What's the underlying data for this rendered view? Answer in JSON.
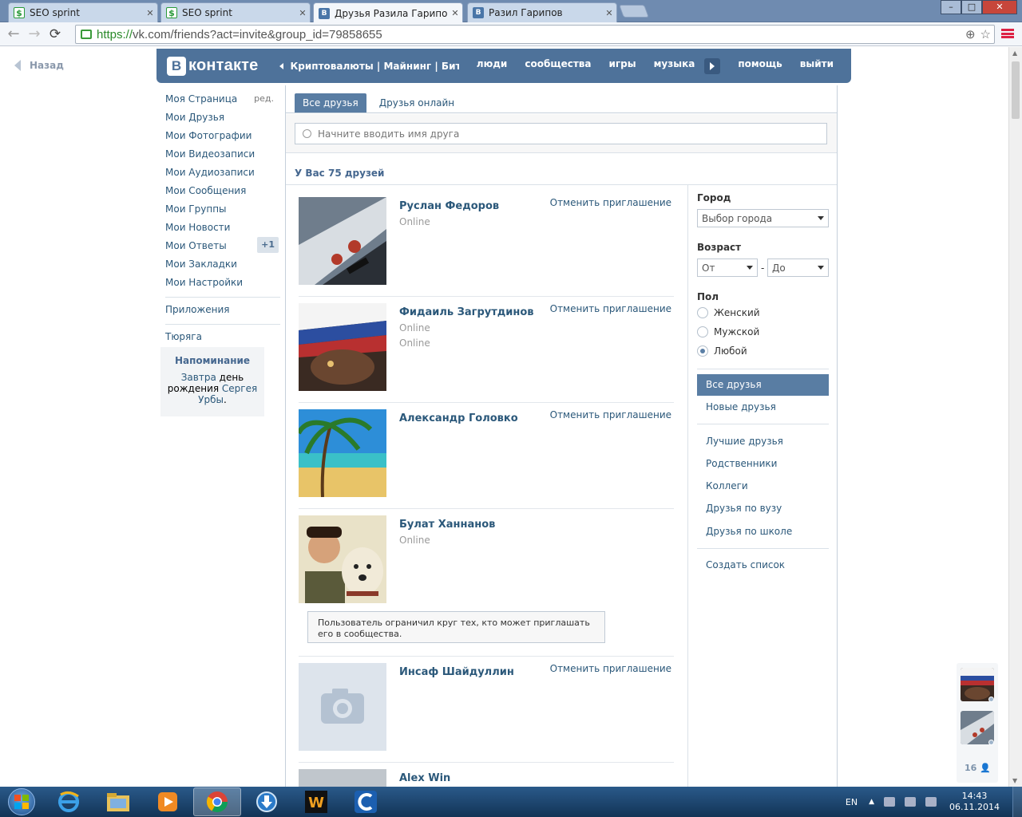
{
  "browser": {
    "tabs": [
      {
        "title": "SEO sprint",
        "icon": "seo-favicon",
        "active": false
      },
      {
        "title": "SEO sprint",
        "icon": "seo-favicon",
        "active": false
      },
      {
        "title": "Друзья Разила Гарипова",
        "icon": "vk-favicon",
        "active": true
      },
      {
        "title": "Разил Гарипов",
        "icon": "vk-favicon",
        "active": false
      }
    ],
    "url_scheme": "https://",
    "url_rest": "vk.com/friends?act=invite&group_id=79858655"
  },
  "page": {
    "back_label": "Назад"
  },
  "header": {
    "logo_letter": "В",
    "logo_text": "контакте",
    "ticker": "Криптовалюты | Майнинг | Битк...",
    "nav": [
      "люди",
      "сообщества",
      "игры",
      "музыка"
    ],
    "nav_right": [
      "помощь",
      "выйти"
    ]
  },
  "left_menu": {
    "items": [
      "Моя Страница",
      "Мои Друзья",
      "Мои Фотографии",
      "Мои Видеозаписи",
      "Мои Аудиозаписи",
      "Мои Сообщения",
      "Мои Группы",
      "Мои Новости",
      "Мои Ответы",
      "Мои Закладки",
      "Мои Настройки"
    ],
    "edit_label": "ред.",
    "answers_badge": "+1",
    "apps": "Приложения",
    "extra": "Тюряга"
  },
  "reminder": {
    "title": "Напоминание",
    "tomorrow": "Завтра",
    "day": " день",
    "birthday": "рождения ",
    "name1": "Сергея",
    "name2": "Урбы",
    "dot": "."
  },
  "friends": {
    "tabs": [
      "Все друзья",
      "Друзья онлайн"
    ],
    "search_placeholder": "Начните вводить имя друга",
    "count": "У Вас 75 друзей",
    "cancel_label": "Отменить приглашение",
    "items": [
      {
        "name": "Руслан Федоров",
        "status": [
          "Online"
        ]
      },
      {
        "name": "Фидаиль Загрутдинов",
        "status": [
          "Online",
          "Online"
        ]
      },
      {
        "name": "Александр Головко",
        "status": []
      },
      {
        "name": "Булат Ханнанов",
        "status": [
          "Online"
        ],
        "note": "Пользователь ограничил круг тех, кто может приглашать его в сообщества."
      },
      {
        "name": "Инсаф Шайдуллин",
        "status": []
      },
      {
        "name": "Alex Win",
        "status": []
      }
    ]
  },
  "filters": {
    "city_label": "Город",
    "city_value": "Выбор города",
    "age_label": "Возраст",
    "age_from": "От",
    "age_dash": "-",
    "age_to": "До",
    "gender_label": "Пол",
    "genders": [
      "Женский",
      "Мужской",
      "Любой"
    ],
    "gender_selected": 2,
    "lists": [
      "Все друзья",
      "Новые друзья"
    ],
    "lists2": [
      "Лучшие друзья",
      "Родственники",
      "Коллеги",
      "Друзья по вузу",
      "Друзья по школе"
    ],
    "create": "Создать список"
  },
  "chat": {
    "count": "16"
  },
  "taskbar": {
    "lang": "EN",
    "time": "14:43",
    "date": "06.11.2014"
  },
  "colors": {
    "vk_blue": "#4e729a",
    "link": "#2b587a",
    "active_tab": "#597da3"
  }
}
